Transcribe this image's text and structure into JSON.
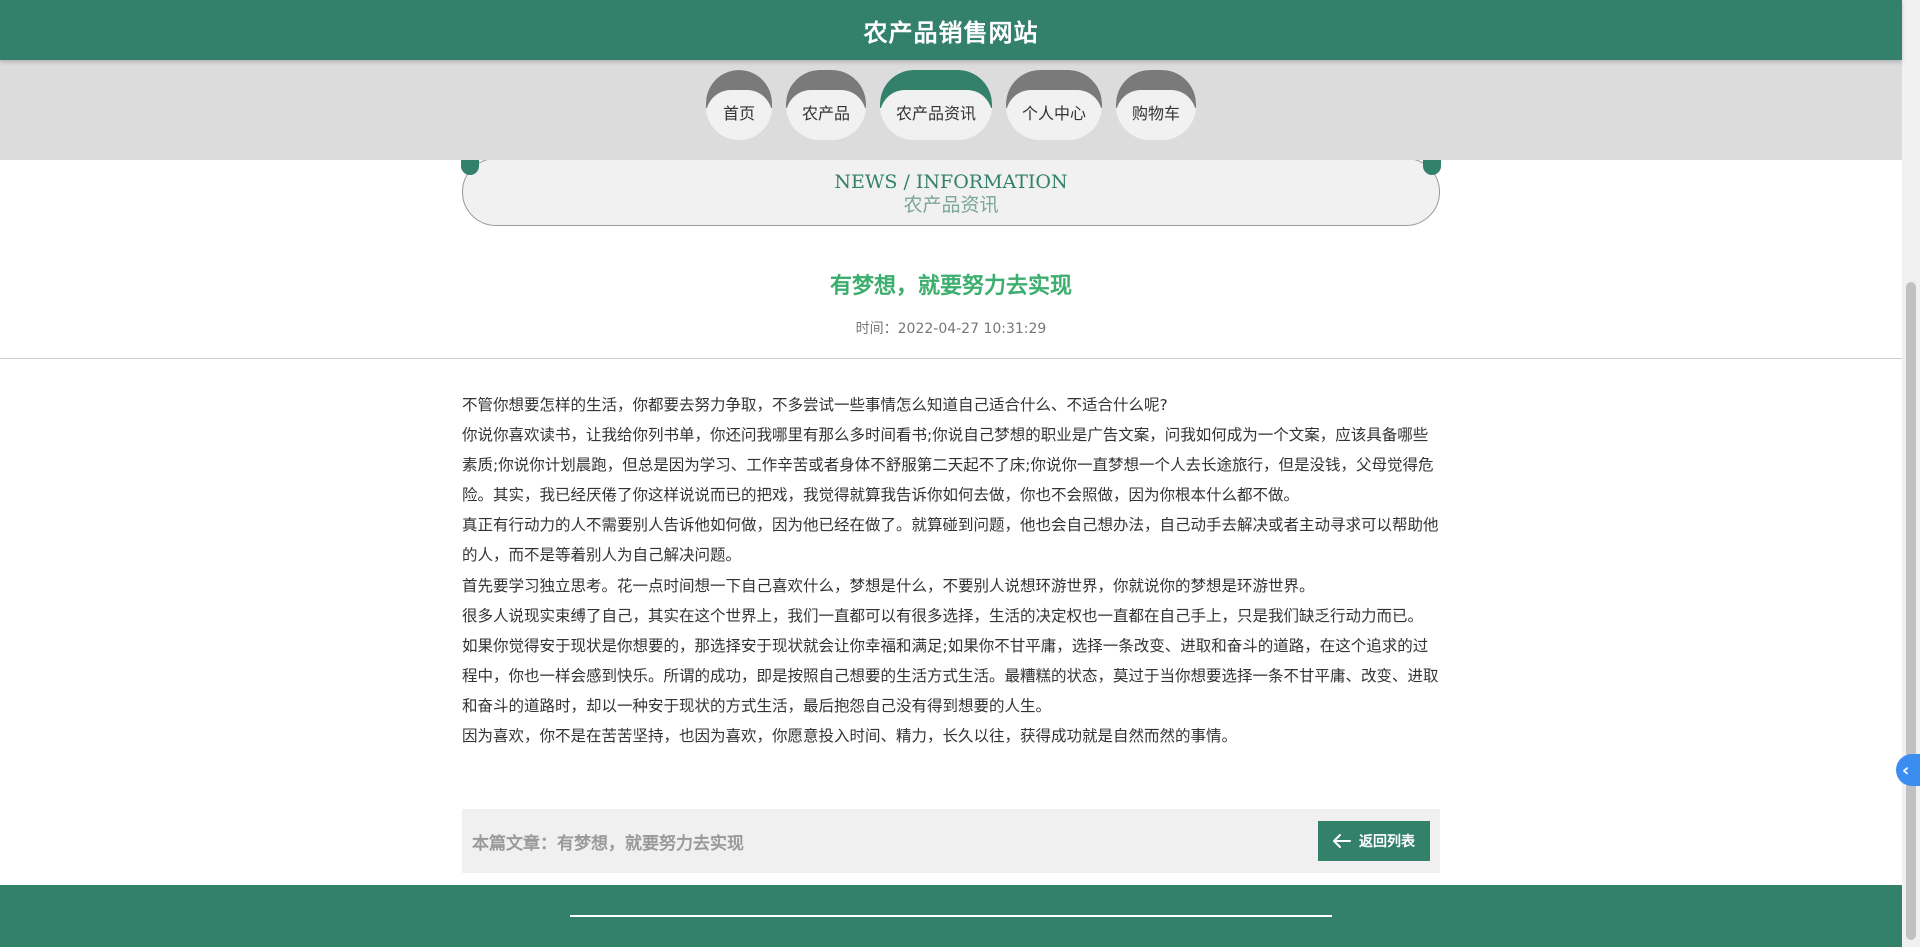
{
  "header": {
    "title": "农产品销售网站"
  },
  "nav": {
    "items": [
      {
        "label": "首页",
        "active": false
      },
      {
        "label": "农产品",
        "active": false
      },
      {
        "label": "农产品资讯",
        "active": true
      },
      {
        "label": "个人中心",
        "active": false
      },
      {
        "label": "购物车",
        "active": false
      }
    ]
  },
  "section": {
    "en": "NEWS / INFORMATION",
    "cn": "农产品资讯"
  },
  "article": {
    "title": "有梦想，就要努力去实现",
    "time": "时间：2022-04-27 10:31:29",
    "paragraphs": [
      "不管你想要怎样的生活，你都要去努力争取，不多尝试一些事情怎么知道自己适合什么、不适合什么呢?",
      "你说你喜欢读书，让我给你列书单，你还问我哪里有那么多时间看书;你说自己梦想的职业是广告文案，问我如何成为一个文案，应该具备哪些素质;你说你计划晨跑，但总是因为学习、工作辛苦或者身体不舒服第二天起不了床;你说你一直梦想一个人去长途旅行，但是没钱，父母觉得危险。其实，我已经厌倦了你这样说说而已的把戏，我觉得就算我告诉你如何去做，你也不会照做，因为你根本什么都不做。",
      "真正有行动力的人不需要别人告诉他如何做，因为他已经在做了。就算碰到问题，他也会自己想办法，自己动手去解决或者主动寻求可以帮助他的人，而不是等着别人为自己解决问题。",
      "首先要学习独立思考。花一点时间想一下自己喜欢什么，梦想是什么，不要别人说想环游世界，你就说你的梦想是环游世界。",
      "很多人说现实束缚了自己，其实在这个世界上，我们一直都可以有很多选择，生活的决定权也一直都在自己手上，只是我们缺乏行动力而已。",
      "如果你觉得安于现状是你想要的，那选择安于现状就会让你幸福和满足;如果你不甘平庸，选择一条改变、进取和奋斗的道路，在这个追求的过程中，你也一样会感到快乐。所谓的成功，即是按照自己想要的生活方式生活。最糟糕的状态，莫过于当你想要选择一条不甘平庸、改变、进取和奋斗的道路时，却以一种安于现状的方式生活，最后抱怨自己没有得到想要的人生。",
      "因为喜欢，你不是在苦苦坚持，也因为喜欢，你愿意投入时间、精力，长久以往，获得成功就是自然而然的事情。"
    ],
    "footer_label": "本篇文章：有梦想，就要努力去实现",
    "back_label": "返回列表"
  },
  "colors": {
    "primary": "#33806b",
    "title_green": "#3cae6e",
    "nav_band": "#dcdcdc",
    "side_toggle": "#3b8ef0"
  },
  "icons": {
    "back": "arrow-left-icon",
    "side_toggle": "chevron-left-icon"
  }
}
